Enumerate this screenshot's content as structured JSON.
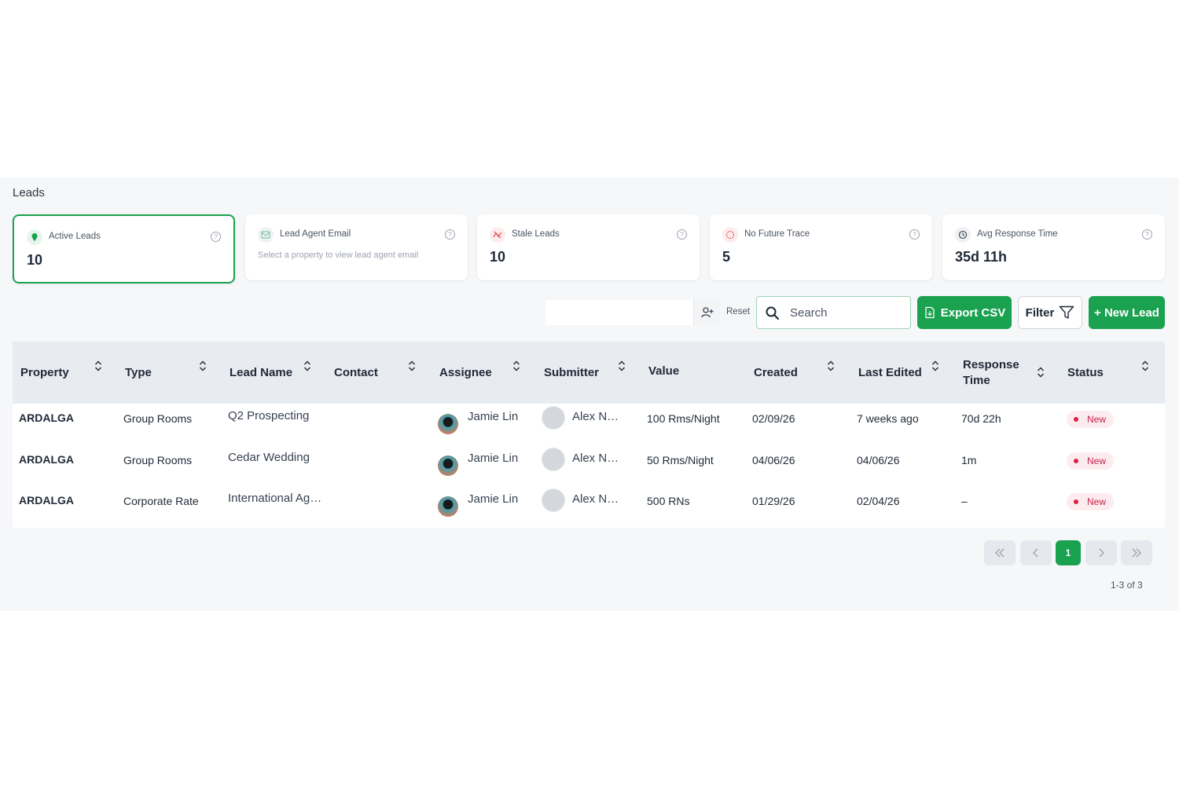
{
  "page": {
    "title": "Leads"
  },
  "cards": [
    {
      "label": "Active Leads",
      "value": "10",
      "icon": "location-pin-icon",
      "color": "#1aa250"
    },
    {
      "label": "Lead Agent Email",
      "sub": "Select a property to view lead agent email",
      "icon": "mail-icon",
      "color": "#1aa250"
    },
    {
      "label": "Stale Leads",
      "value": "10",
      "icon": "trend-off-icon",
      "color": "#e5484d"
    },
    {
      "label": "No Future Trace",
      "value": "5",
      "icon": "alert-circle-icon",
      "color": "#e5484d"
    },
    {
      "label": "Avg Response Time",
      "value": "35d 11h",
      "icon": "clock-icon",
      "color": "#374151"
    }
  ],
  "toolbar": {
    "reset": "Reset",
    "search_placeholder": "Search",
    "export": "Export CSV",
    "filter": "Filter",
    "new_lead": "+ New Lead"
  },
  "table": {
    "columns": [
      "Property",
      "Type",
      "Lead Name",
      "Contact",
      "Assignee",
      "Submitter",
      "Value",
      "Created",
      "Last Edited",
      "Response Time",
      "Status"
    ],
    "rows": [
      {
        "property": "ARDALGA",
        "type": "Group Rooms",
        "lead_name": "Q2 Prospecting",
        "contact": "",
        "assignee": "Jamie Lin",
        "submitter": "Alex N…",
        "value": "100 Rms/Night",
        "created": "02/09/26",
        "last_edited": "7 weeks ago",
        "response_time": "70d 22h",
        "status": "New"
      },
      {
        "property": "ARDALGA",
        "type": "Group Rooms",
        "lead_name": "Cedar Wedding",
        "contact": "",
        "assignee": "Jamie Lin",
        "submitter": "Alex N…",
        "value": "50 Rms/Night",
        "created": "04/06/26",
        "last_edited": "04/06/26",
        "response_time": "1m",
        "status": "New"
      },
      {
        "property": "ARDALGA",
        "type": "Corporate Rate",
        "lead_name": "International Ag…",
        "contact": "",
        "assignee": "Jamie Lin",
        "submitter": "Alex N…",
        "value": "500 RNs",
        "created": "01/29/26",
        "last_edited": "02/04/26",
        "response_time": "–",
        "status": "New"
      }
    ]
  },
  "pagination": {
    "current": "1",
    "range": "1-3 of 3"
  }
}
